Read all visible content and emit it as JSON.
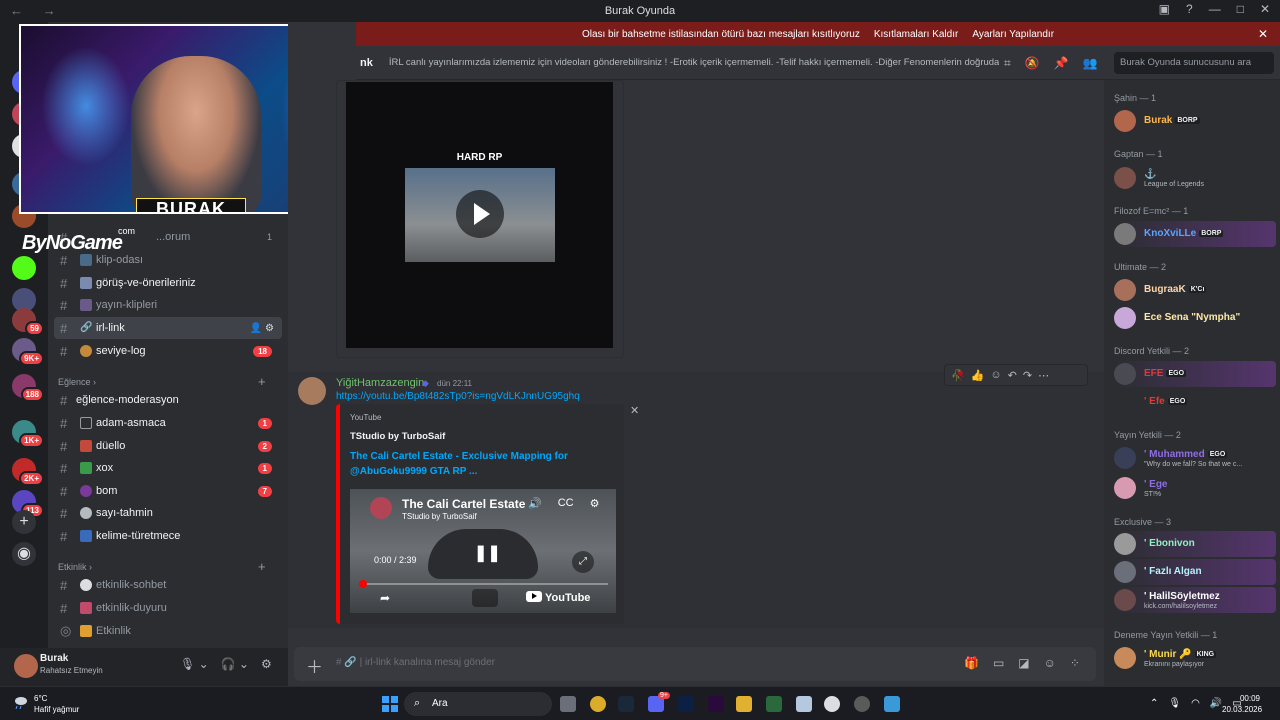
{
  "window": {
    "title": "Burak Oyunda",
    "nav": "← →",
    "controls": [
      "▣",
      "?",
      "—",
      "□",
      "✕"
    ]
  },
  "banner": {
    "text": "Olası bir bahsetme istilasından ötürü bazı mesajları kısıtlıyoruz",
    "btn1": "Kısıtlamaları Kaldır",
    "btn2": "Ayarları Yapılandır",
    "close": "✕"
  },
  "topbar": {
    "channel": "nk",
    "topic": "İRL canlı yayınlarımızda izlememiz için videoları gönderebilirsiniz ! -Erotik içerik içermemeli. -Telif hakkı içermemeli. -Diğer Fenomenlerin doğrudan ke...",
    "search_placeholder": "Burak Oyunda sunucusunu ara",
    "icons": [
      "threads-icon",
      "mute-icon",
      "pin-icon",
      "members-icon"
    ]
  },
  "overlay": {
    "plate": "BURAK",
    "brand": "ByNoGame",
    "brand_sub": "com"
  },
  "sidebar": {
    "partial_channel": "...orum",
    "partial_count": "1",
    "channels": [
      {
        "name": "klip-odası",
        "muted": true
      },
      {
        "name": "görüş-ve-önerileriniz",
        "muted": false
      },
      {
        "name": "yayın-klipleri",
        "muted": true
      },
      {
        "name": "irl-link",
        "active": true
      },
      {
        "name": "seviye-log",
        "count": "18"
      }
    ],
    "cat_eglence": "Eğlence",
    "eglence": [
      {
        "name": "eğlence-moderasyon"
      },
      {
        "name": "adam-asmaca",
        "count": "1"
      },
      {
        "name": "düello",
        "count": "2"
      },
      {
        "name": "xox",
        "count": "1"
      },
      {
        "name": "bom",
        "count": "7"
      },
      {
        "name": "sayı-tahmin"
      },
      {
        "name": "kelime-türetmece"
      }
    ],
    "cat_etkinlik": "Etkinlik",
    "etkinlik": [
      {
        "name": "etkinlik-sohbet"
      },
      {
        "name": "etkinlik-duyuru"
      },
      {
        "name": "Etkinlik"
      }
    ]
  },
  "guild_badges": [
    "59",
    "9K+",
    "188",
    "1K+",
    "2K+",
    "113"
  ],
  "video1": {
    "label": "HARD RP"
  },
  "message": {
    "author": "YiğitHamzazengin",
    "time": "dün 22:11",
    "link": "https://youtu.be/Bp8t482sTp0?is=ngVdLKJnnUG95ghq",
    "embed": {
      "provider": "YouTube",
      "author": "TStudio by TurboSaif",
      "title": "The Cali Cartel Estate - Exclusive Mapping for @AbuGoku9999 GTA RP ...",
      "video_title": "The Cali Cartel Estate",
      "video_channel": "TStudio by TurboSaif",
      "time": "0:00 / 2:39",
      "logo": "YouTube"
    }
  },
  "composer": {
    "placeholder": "# 🔗 | irl-link kanalına mesaj gönder"
  },
  "user": {
    "name": "Burak",
    "status": "Rahatsız Etmeyin"
  },
  "members": {
    "groups": [
      {
        "label": "Şahin — 1"
      },
      {
        "label": "Gaptan — 1"
      },
      {
        "label": "Filozof E=mc² — 1"
      },
      {
        "label": "Ultimate — 2"
      },
      {
        "label": "Discord Yetkili — 2"
      },
      {
        "label": "Yayın Yetkili — 2"
      },
      {
        "label": "Exclusive — 3"
      },
      {
        "label": "Deneme Yayın Yetkili — 1"
      }
    ],
    "list": [
      {
        "name": "Burak",
        "tag": "BORP",
        "color": "#ffb84d"
      },
      {
        "name": "⚓",
        "sub": "League of Legends",
        "color": "#e03a3a"
      },
      {
        "name": "KnoXviLLe",
        "tag": "BORP",
        "color": "#58a6ff"
      },
      {
        "name": "BugraaK",
        "tag": "K'Cı",
        "color": "#ffd5a8"
      },
      {
        "name": "Ece Sena \"Nympha\"",
        "color": "#ffe9a8"
      },
      {
        "name": "EFE",
        "tag": "EGO",
        "color": "#e03a3a"
      },
      {
        "name": "' Efe",
        "tag": "EGO",
        "color": "#e03a3a"
      },
      {
        "name": "' Muhammed",
        "tag": "EGO",
        "sub": "\"Why do we fall? So that we c...",
        "color": "#8f6de3"
      },
      {
        "name": "' Ege",
        "sub": "ST!%",
        "color": "#8f6de3"
      },
      {
        "name": "' Ebonivon",
        "color": "#8ef2c0"
      },
      {
        "name": "' Fazlı Algan",
        "color": "#b5f2ff"
      },
      {
        "name": "' HalilSöyletmez",
        "sub": "kick.com/halilsoyletmez",
        "color": "#ffffff"
      },
      {
        "name": "' Munir 🔑",
        "tag": "KING",
        "sub": "Ekranını paylaşıyor",
        "color": "#ffd84d"
      }
    ]
  },
  "taskbar": {
    "temp": "6°C",
    "condition": "Hafif yağmur",
    "search": "Ara",
    "time": "00:09",
    "date": "20.03.2026",
    "discord_badge": "9+"
  }
}
